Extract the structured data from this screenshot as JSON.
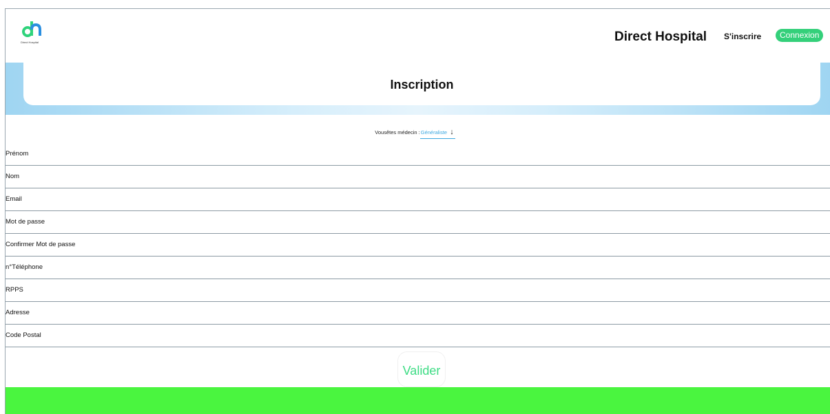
{
  "logo": {
    "caption": "Direct Hospital",
    "colors": [
      "#2fd37b",
      "#2b8fe0"
    ]
  },
  "header": {
    "brand": "Direct Hospital",
    "signup_label": "S'inscrire",
    "login_label": "Connexion"
  },
  "hero": {
    "title": "Inscription"
  },
  "doctor_type": {
    "label": "Vousêtes médecin :",
    "selected": "Généraliste",
    "arrow": "↓"
  },
  "fields": [
    {
      "placeholder": "Prénom"
    },
    {
      "placeholder": "Nom"
    },
    {
      "placeholder": "Email"
    },
    {
      "placeholder": "Mot de passe"
    },
    {
      "placeholder": "Confirmer Mot de passe"
    },
    {
      "placeholder": "n°Téléphone"
    },
    {
      "placeholder": "RPPS"
    },
    {
      "placeholder": "Adresse"
    },
    {
      "placeholder": "Code Postal"
    }
  ],
  "submit_label": "Valider",
  "colors": {
    "accent_green": "#34d07a",
    "footer_green": "#4af53f",
    "link_blue": "#3aa7e0",
    "banner_blue": "#9fd5f2"
  }
}
